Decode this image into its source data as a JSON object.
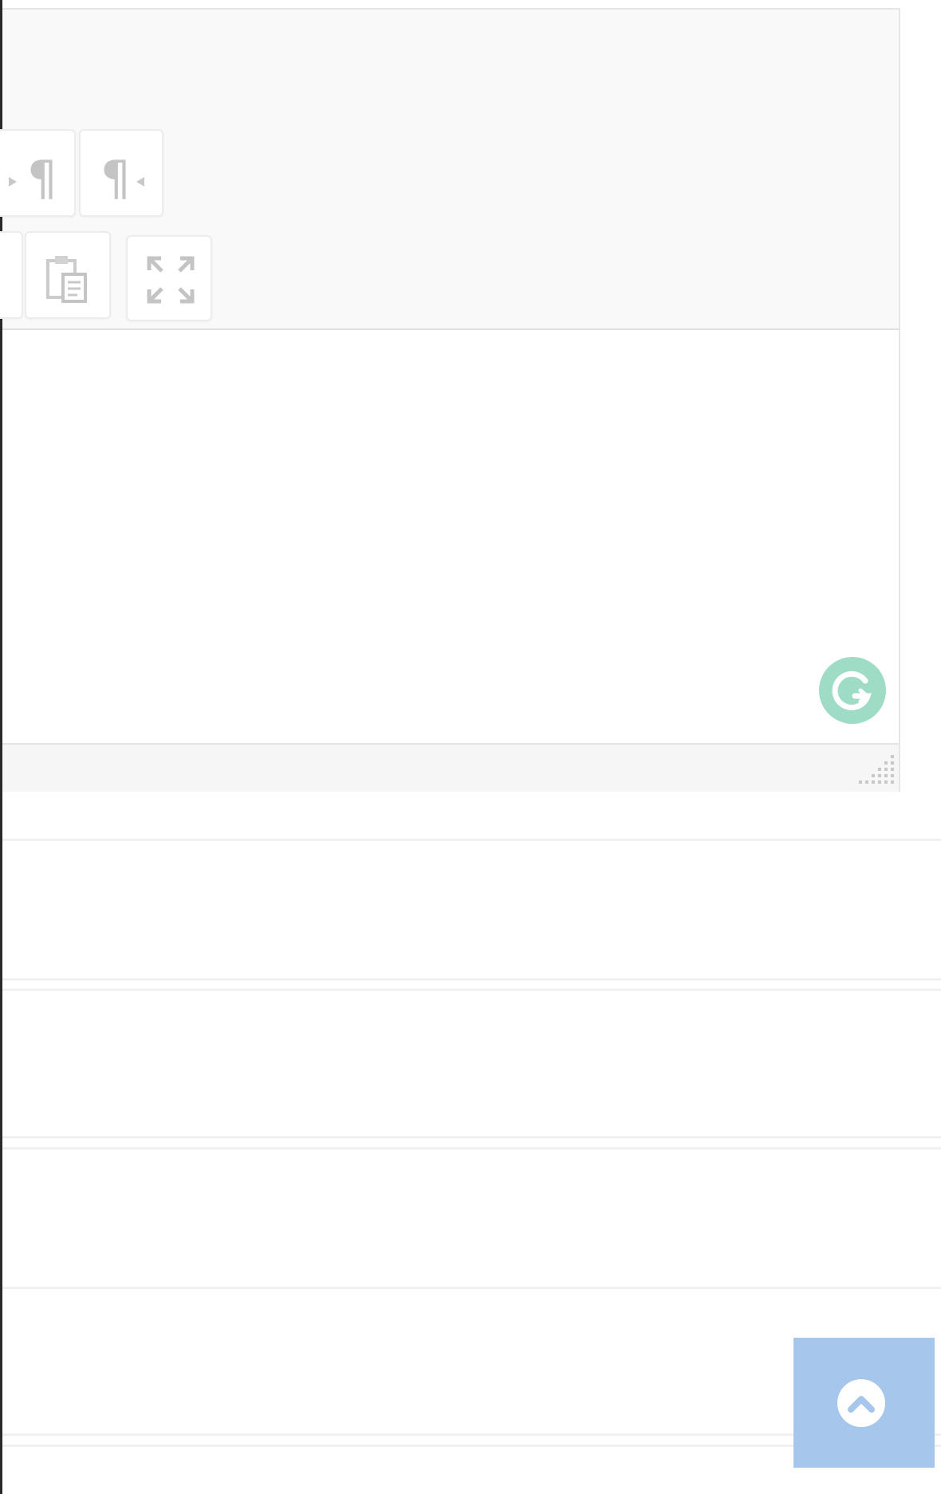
{
  "editor": {
    "toolbar": {
      "row1": [
        {
          "name": "ltr-paragraph-icon"
        },
        {
          "name": "rtl-paragraph-icon"
        }
      ],
      "row2": [
        {
          "name": "paste-from-word-icon"
        },
        {
          "name": "fullscreen-icon"
        }
      ]
    },
    "body_text": "",
    "grammarly_icon": "grammarly-icon",
    "resize_handle_icon": "resize-grip-icon"
  },
  "scroll_to_top": {
    "icon": "chevron-up-icon",
    "color": "#a7c6ec"
  },
  "colors": {
    "toolbar_bg": "#f9f9f9",
    "icon_gray": "#c4c4c4",
    "grammarly": "#9fdcc6"
  }
}
